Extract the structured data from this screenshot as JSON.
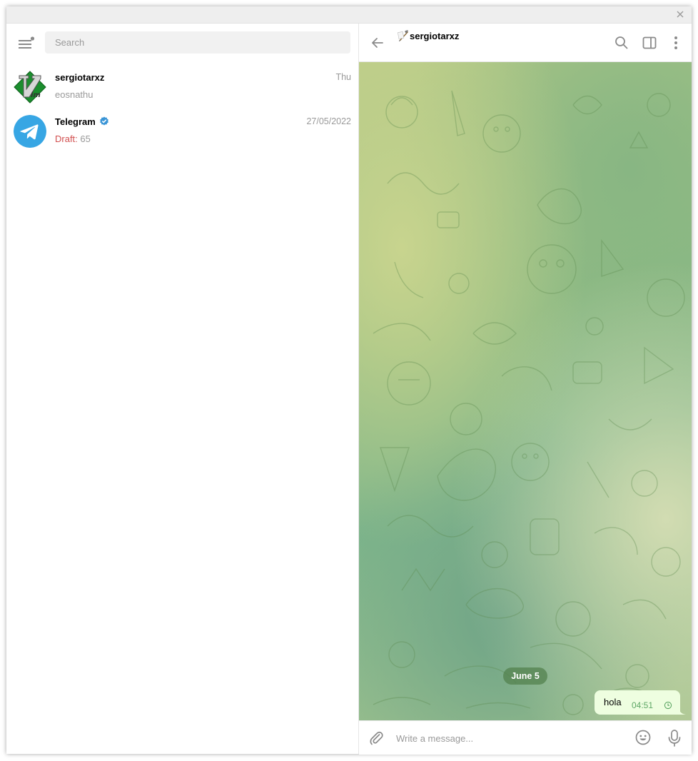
{
  "sidebar": {
    "search": {
      "placeholder": "Search"
    },
    "chats": [
      {
        "name": "sergiotarxz",
        "time": "Thu",
        "preview": "eosnathu"
      },
      {
        "name": "Telegram",
        "time": "27/05/2022",
        "draft_label": "Draft:",
        "preview": "65",
        "verified": true
      }
    ]
  },
  "chat": {
    "title": "sergiotarxz",
    "date_separator": "June 5",
    "messages": [
      {
        "text": "hola",
        "time": "04:51",
        "status": "clock-pending"
      }
    ],
    "composer": {
      "placeholder": "Write a message..."
    }
  },
  "colors": {
    "accent": "#3a95d6",
    "draft": "#d14e4e",
    "outgoing_bubble": "#eefee0",
    "outgoing_time": "#5ea766",
    "telegram_blue": "#37a6e4"
  },
  "icons": {
    "titlebar": [
      "close-icon"
    ],
    "sidebar": [
      "menu-icon",
      "vim-logo-avatar",
      "telegram-logo-avatar",
      "verified-icon"
    ],
    "header": [
      "back-arrow-icon",
      "pen-emoji-icon",
      "search-icon",
      "sidebar-toggle-icon",
      "more-vertical-icon"
    ],
    "composer": [
      "paperclip-icon",
      "emoji-icon",
      "microphone-icon"
    ]
  }
}
